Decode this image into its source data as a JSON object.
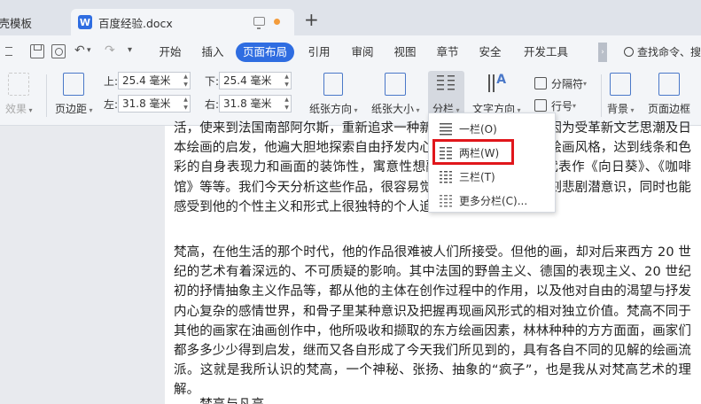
{
  "tabs": {
    "inactive_label": "稻壳模板",
    "active_label": "百度经验.docx",
    "doc_icon_glyph": "W"
  },
  "menu": {
    "items": [
      "开始",
      "插入",
      "页面布局",
      "引用",
      "审阅",
      "视图",
      "章节",
      "安全",
      "开发工具"
    ],
    "active": "页面布局",
    "search_label": "查找命令、搜",
    "undo_glyph": "↶",
    "redo_glyph": "↷",
    "more_glyph": "▾",
    "scroll_glyph": "›"
  },
  "ribbon": {
    "effects_label": "效果",
    "margins_label": "页边距",
    "top_label": "上:",
    "top_value": "25.4 毫米",
    "bottom_label": "下:",
    "bottom_value": "25.4 毫米",
    "left_label": "左:",
    "left_value": "31.8 毫米",
    "right_label": "右:",
    "right_value": "31.8 毫米",
    "orientation_label": "纸张方向",
    "size_label": "纸张大小",
    "columns_label": "分栏",
    "text_direction_label": "文字方向",
    "breaks_label": "分隔符",
    "line_numbers_label": "行号",
    "background_label": "背景",
    "page_border_label": "页面边框"
  },
  "columns_menu": {
    "one": "一栏(O)",
    "two": "两栏(W)",
    "three": "三栏(T)",
    "more": "更多分栏(C)..."
  },
  "document": {
    "para1": "活，使来到法国南部阿尔斯，重新追求一种新的绘画方式和技巧，因为受革新文艺思潮及日本绘画的启发，他遍大胆地探索自由抒发内心地感受，追求自己的绘画风格，达到线条和色彩的自身表现力和画面的装饰性，寓意性想融合。这时期，他的代表作《向日葵》、《咖啡馆》等等。我们今天分析这些作品，很容易觉察到画所包含的那深刻悲剧潜意识，同时也能感受到他的个性主义和形式上很独特的个人追求。",
    "para2": "梵高，在他生活的那个时代，他的作品很难被人们所接受。但他的画，却对后来西方 20 世纪的艺术有着深远的、不可质疑的影响。其中法国的野兽主义、德国的表现主义、20 世纪初的抒情抽象主义作品等，都从他的主体在创作过程中的作用，以及他对自由的渴望与抒发内心复杂的感情世界，和骨子里某种意识及把握再现画风形式的相对独立价值。梵高不同于其他的画家在油画创作中，他所吸收和撷取的东方绘画因素，林林种种的方方面面，画家们都多多少少得到启发，继而又各自形成了今天我们所见到的，具有各自不同的见解的绘画流派。这就是我所认识的梵高，一个神秘、张扬、抽象的“疯子”，也是我从对梵高艺术的理解。",
    "para3": "……梵高与凡高"
  }
}
